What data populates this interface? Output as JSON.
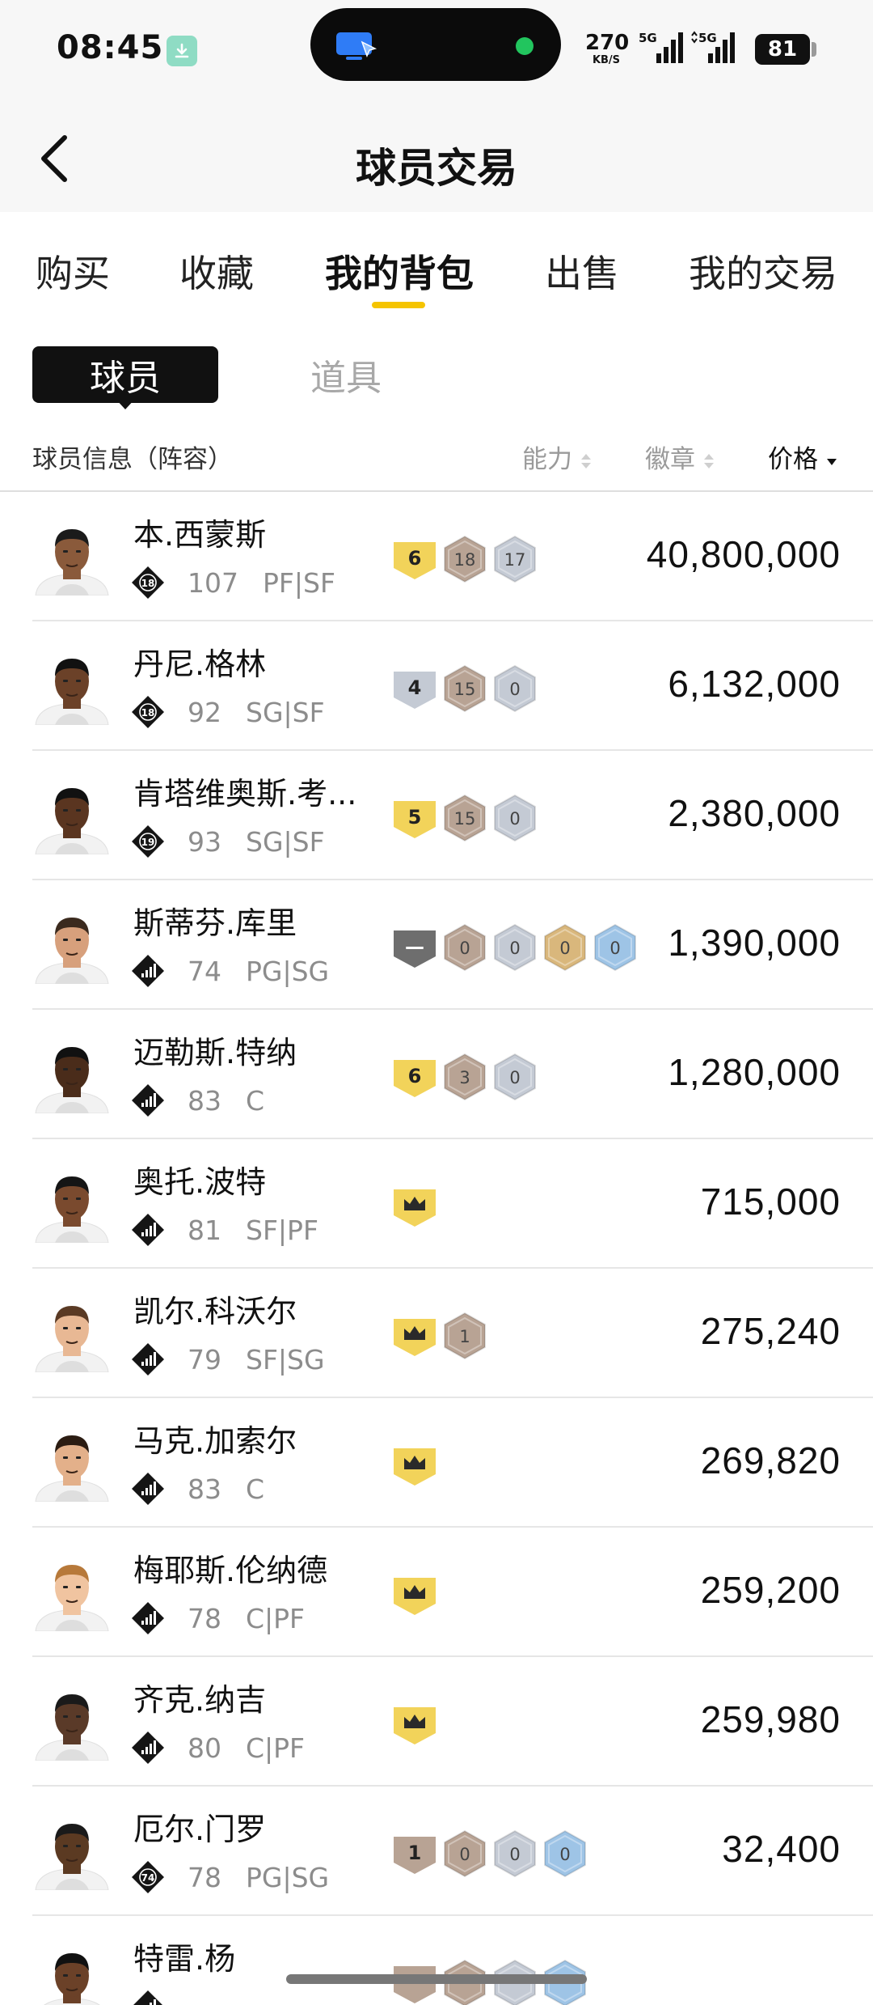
{
  "status_bar": {
    "time": "08:45",
    "net_speed_value": "270",
    "net_speed_unit": "KB/S",
    "signal1_label": "5G",
    "signal2_label": "5G",
    "battery": "81"
  },
  "nav": {
    "title": "球员交易"
  },
  "tabs": [
    {
      "label": "购买",
      "active": false
    },
    {
      "label": "收藏",
      "active": false
    },
    {
      "label": "我的背包",
      "active": true
    },
    {
      "label": "出售",
      "active": false
    },
    {
      "label": "我的交易",
      "active": false
    }
  ],
  "segments": {
    "active": "球员",
    "inactive": "道具"
  },
  "list_header": {
    "info": "球员信息（阵容）",
    "ability": "能力",
    "badges": "徽章",
    "price": "价格",
    "sort_active": "价格"
  },
  "colors": {
    "accent": "#f5c400",
    "gold_tag": "#f2d35a",
    "bronze": "#b8a394",
    "silver": "#c4cad4",
    "gold_badge": "#d9b77c",
    "blue_badge": "#9ec4e6",
    "dark_tag": "#6e6e6e"
  },
  "players": [
    {
      "name": "本.西蒙斯",
      "icon": "rank-18",
      "rating": "107",
      "pos": "PF|SF",
      "price": "40,800,000",
      "badges": [
        {
          "type": "tag",
          "color": "gold",
          "text": "6"
        },
        {
          "type": "hex",
          "color": "bronze",
          "text": "18"
        },
        {
          "type": "hex",
          "color": "silver",
          "text": "17"
        }
      ]
    },
    {
      "name": "丹尼.格林",
      "icon": "rank-18",
      "rating": "92",
      "pos": "SG|SF",
      "price": "6,132,000",
      "badges": [
        {
          "type": "tag",
          "color": "silver",
          "text": "4"
        },
        {
          "type": "hex",
          "color": "bronze",
          "text": "15"
        },
        {
          "type": "hex",
          "color": "silver",
          "text": "0"
        }
      ]
    },
    {
      "name": "肯塔维奥斯.考...",
      "icon": "rank-19",
      "rating": "93",
      "pos": "SG|SF",
      "price": "2,380,000",
      "badges": [
        {
          "type": "tag",
          "color": "gold",
          "text": "5"
        },
        {
          "type": "hex",
          "color": "bronze",
          "text": "15"
        },
        {
          "type": "hex",
          "color": "silver",
          "text": "0"
        }
      ]
    },
    {
      "name": "斯蒂芬.库里",
      "icon": "signal",
      "rating": "74",
      "pos": "PG|SG",
      "price": "1,390,000",
      "badges": [
        {
          "type": "tag",
          "color": "dark",
          "text": "—"
        },
        {
          "type": "hex",
          "color": "bronze",
          "text": "0"
        },
        {
          "type": "hex",
          "color": "silver",
          "text": "0"
        },
        {
          "type": "hex",
          "color": "gold",
          "text": "0"
        },
        {
          "type": "hex",
          "color": "blue",
          "text": "0"
        }
      ]
    },
    {
      "name": "迈勒斯.特纳",
      "icon": "signal",
      "rating": "83",
      "pos": "C",
      "price": "1,280,000",
      "badges": [
        {
          "type": "tag",
          "color": "gold",
          "text": "6"
        },
        {
          "type": "hex",
          "color": "bronze",
          "text": "3"
        },
        {
          "type": "hex",
          "color": "silver",
          "text": "0"
        }
      ]
    },
    {
      "name": "奥托.波特",
      "icon": "signal",
      "rating": "81",
      "pos": "SF|PF",
      "price": "715,000",
      "badges": [
        {
          "type": "crown",
          "color": "gold",
          "text": ""
        }
      ]
    },
    {
      "name": "凯尔.科沃尔",
      "icon": "signal",
      "rating": "79",
      "pos": "SF|SG",
      "price": "275,240",
      "badges": [
        {
          "type": "crown",
          "color": "gold",
          "text": ""
        },
        {
          "type": "hex",
          "color": "bronze",
          "text": "1"
        }
      ]
    },
    {
      "name": "马克.加索尔",
      "icon": "signal",
      "rating": "83",
      "pos": "C",
      "price": "269,820",
      "badges": [
        {
          "type": "crown",
          "color": "gold",
          "text": ""
        }
      ]
    },
    {
      "name": "梅耶斯.伦纳德",
      "icon": "signal",
      "rating": "78",
      "pos": "C|PF",
      "price": "259,200",
      "badges": [
        {
          "type": "crown",
          "color": "gold",
          "text": ""
        }
      ]
    },
    {
      "name": "齐克.纳吉",
      "icon": "signal",
      "rating": "80",
      "pos": "C|PF",
      "price": "259,980",
      "badges": [
        {
          "type": "crown",
          "color": "gold",
          "text": ""
        }
      ]
    },
    {
      "name": "厄尔.门罗",
      "icon": "rank-74",
      "rating": "78",
      "pos": "PG|SG",
      "price": "32,400",
      "badges": [
        {
          "type": "tag",
          "color": "bronze",
          "text": "1"
        },
        {
          "type": "hex",
          "color": "bronze",
          "text": "0"
        },
        {
          "type": "hex",
          "color": "silver",
          "text": "0"
        },
        {
          "type": "hex",
          "color": "blue",
          "text": "0"
        }
      ]
    },
    {
      "name": "特雷.杨",
      "icon": "signal",
      "rating": "",
      "pos": "",
      "price": "",
      "badges": [
        {
          "type": "tag",
          "color": "bronze",
          "text": ""
        },
        {
          "type": "hex",
          "color": "bronze",
          "text": ""
        },
        {
          "type": "hex",
          "color": "silver",
          "text": ""
        },
        {
          "type": "hex",
          "color": "blue",
          "text": ""
        }
      ]
    }
  ]
}
